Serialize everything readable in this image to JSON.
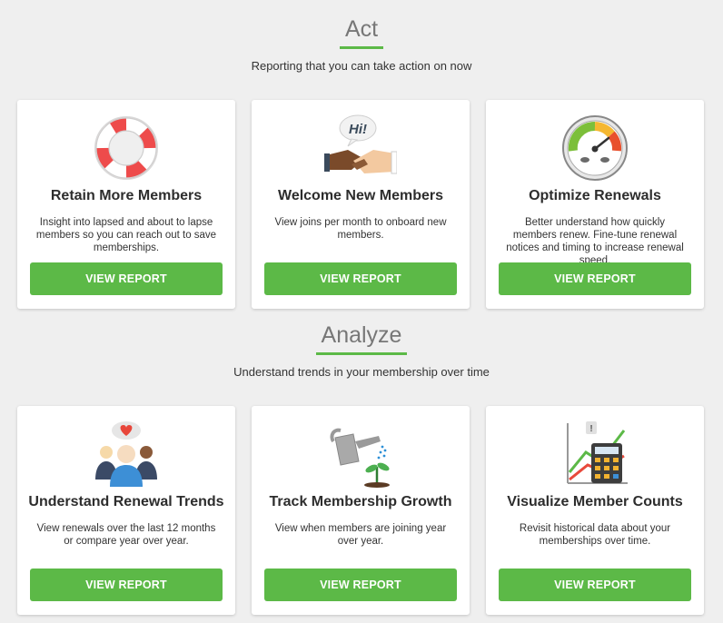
{
  "sections": [
    {
      "title": "Act",
      "subtitle": "Reporting that you can take action on now",
      "cards": [
        {
          "icon": "life-ring-icon",
          "title": "Retain More Members",
          "description": "Insight into lapsed and about to lapse members so you can reach out to save memberships.",
          "button": "VIEW REPORT"
        },
        {
          "icon": "handshake-icon",
          "title": "Welcome New Members",
          "description": "View joins per month to onboard new members.",
          "button": "VIEW REPORT",
          "bubble_text": "Hi!"
        },
        {
          "icon": "speedometer-icon",
          "title": "Optimize Renewals",
          "description": "Better understand how quickly members renew. Fine-tune renewal notices and timing to increase renewal speed.",
          "button": "VIEW REPORT"
        }
      ]
    },
    {
      "title": "Analyze",
      "subtitle": "Understand trends in your membership over time",
      "cards": [
        {
          "icon": "people-heart-icon",
          "title": "Understand Renewal Trends",
          "description": "View renewals over the last 12 months or compare year over year.",
          "button": "VIEW REPORT"
        },
        {
          "icon": "watering-can-icon",
          "title": "Track Membership Growth",
          "description": "View when members are joining year over year.",
          "button": "VIEW REPORT"
        },
        {
          "icon": "chart-calculator-icon",
          "title": "Visualize Member Counts",
          "description": "Revisit historical data about your memberships over time.",
          "button": "VIEW REPORT"
        }
      ]
    }
  ],
  "colors": {
    "accent": "#5cb947",
    "background": "#efefef",
    "card": "#ffffff"
  }
}
